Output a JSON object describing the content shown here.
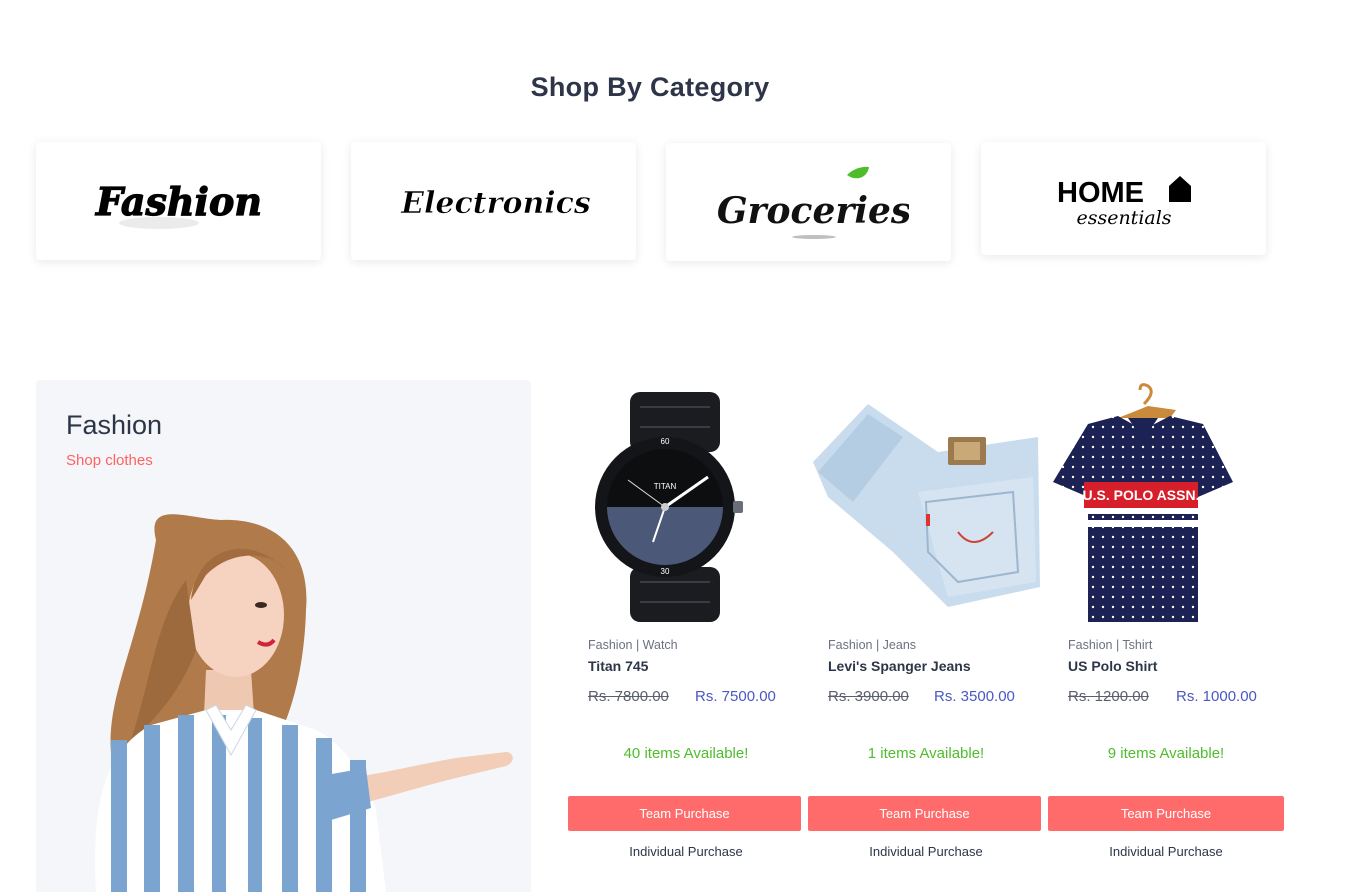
{
  "section": {
    "title": "Shop By Category"
  },
  "categories": [
    {
      "label": "Fashion"
    },
    {
      "label": "Electronics"
    },
    {
      "label": "Groceries"
    },
    {
      "label": "HOME",
      "sublabel": "essentials"
    }
  ],
  "promo": {
    "title": "Fashion",
    "subtitle": "Shop clothes"
  },
  "products": [
    {
      "category": "Fashion | Watch",
      "name": "Titan 745",
      "old_price": "Rs. 7800.00",
      "new_price": "Rs. 7500.00",
      "availability": "40 items Available!",
      "team_label": "Team Purchase",
      "individual_label": "Individual Purchase",
      "watch_brand": "TITAN",
      "watch_12": "60",
      "watch_6": "30"
    },
    {
      "category": "Fashion | Jeans",
      "name": "Levi's Spanger Jeans",
      "old_price": "Rs. 3900.00",
      "new_price": "Rs. 3500.00",
      "availability": "1 items Available!",
      "team_label": "Team Purchase",
      "individual_label": "Individual Purchase"
    },
    {
      "category": "Fashion | Tshirt",
      "name": "US Polo Shirt",
      "old_price": "Rs. 1200.00",
      "new_price": "Rs. 1000.00",
      "availability": "9 items Available!",
      "team_label": "Team Purchase",
      "individual_label": "Individual Purchase",
      "shirt_print": "U.S. POLO ASSN."
    }
  ],
  "colors": {
    "accent": "#ff6b6b",
    "price": "#4b57c3",
    "available": "#4ebd2c",
    "promo_bg": "#f4f6f9",
    "heading": "#2e3548"
  }
}
